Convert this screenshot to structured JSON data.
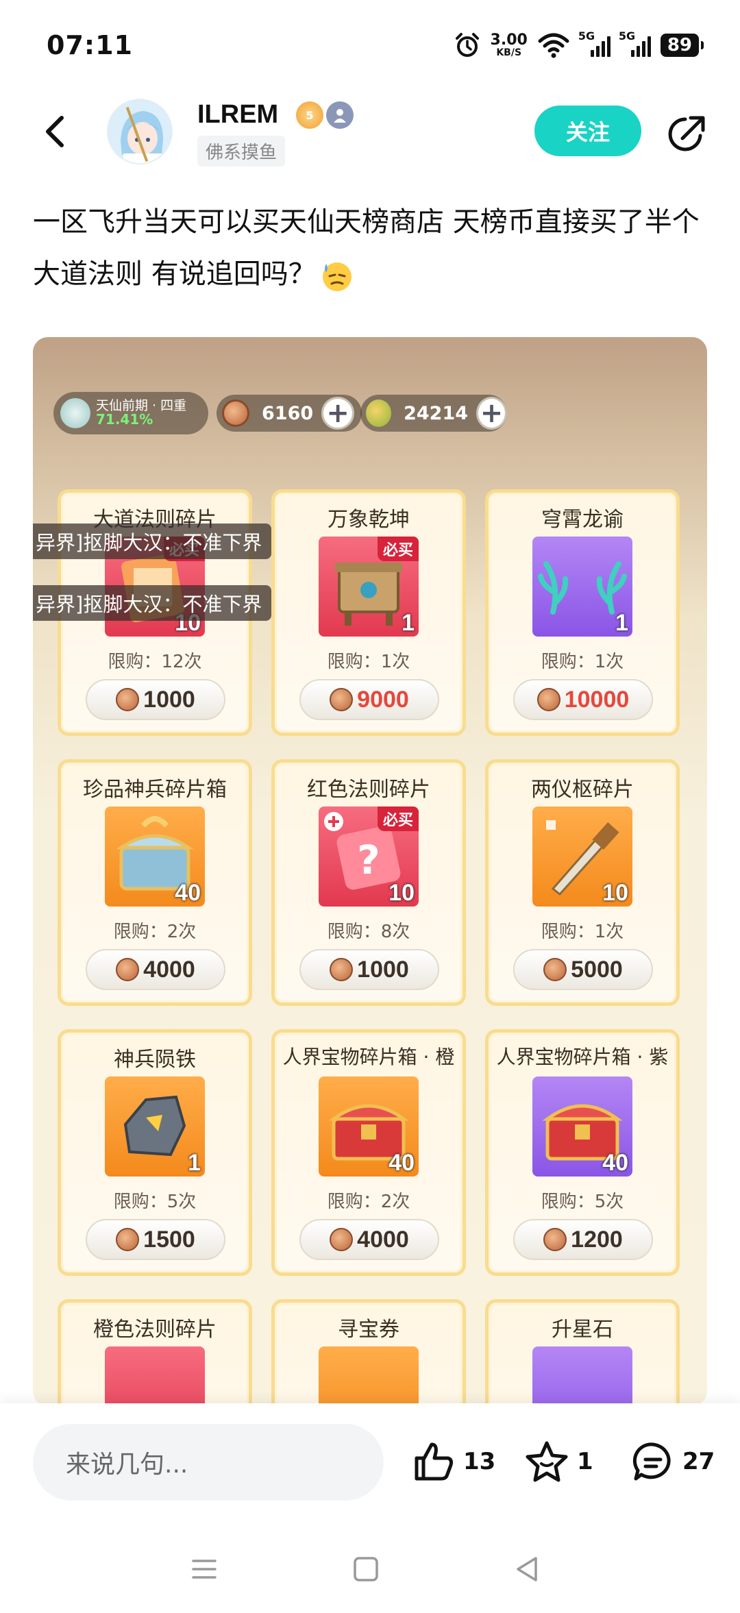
{
  "status_bar": {
    "time": "07:11",
    "network_speed_value": "3.00",
    "network_speed_unit": "KB/S",
    "signal1_label": "5G",
    "signal2_label": "5G",
    "battery": "89"
  },
  "header": {
    "username": "ILREM",
    "level_badge": "5",
    "user_tag": "佛系摸鱼",
    "follow_label": "关注"
  },
  "post": {
    "text": "一区飞升当天可以买天仙天榜商店 天榜币直接买了半个大道法则 有说追回吗？"
  },
  "game": {
    "realm_name": "天仙前期 · 四重",
    "realm_progress": "71.41%",
    "currency1_value": "6160",
    "currency2_value": "24214",
    "plus_label": "+",
    "must_buy_label": "必买",
    "chat_messages": [
      "异界]抠脚大汉：不准下界",
      "异界]抠脚大汉：不准下界"
    ],
    "items": [
      {
        "name": "大道法则碎片",
        "qty": "10",
        "limit": "限购：12次",
        "price": "1000",
        "must_buy": true,
        "price_red": false,
        "color": "red"
      },
      {
        "name": "万象乾坤",
        "qty": "1",
        "limit": "限购：1次",
        "price": "9000",
        "must_buy": true,
        "price_red": true,
        "color": "red"
      },
      {
        "name": "穹霄龙谕",
        "qty": "1",
        "limit": "限购：1次",
        "price": "10000",
        "must_buy": false,
        "price_red": true,
        "color": "purple"
      },
      {
        "name": "珍品神兵碎片箱",
        "qty": "40",
        "limit": "限购：2次",
        "price": "4000",
        "must_buy": false,
        "price_red": false,
        "color": "orange"
      },
      {
        "name": "红色法则碎片",
        "qty": "10",
        "limit": "限购：8次",
        "price": "1000",
        "must_buy": true,
        "price_red": false,
        "color": "red"
      },
      {
        "name": "两仪枢碎片",
        "qty": "10",
        "limit": "限购：1次",
        "price": "5000",
        "must_buy": false,
        "price_red": false,
        "color": "orange"
      },
      {
        "name": "神兵陨铁",
        "qty": "1",
        "limit": "限购：5次",
        "price": "1500",
        "must_buy": false,
        "price_red": false,
        "color": "orange"
      },
      {
        "name": "人界宝物碎片箱 · 橙",
        "qty": "40",
        "limit": "限购：2次",
        "price": "4000",
        "must_buy": false,
        "price_red": false,
        "color": "orange"
      },
      {
        "name": "人界宝物碎片箱 · 紫",
        "qty": "40",
        "limit": "限购：5次",
        "price": "1200",
        "must_buy": false,
        "price_red": false,
        "color": "purple"
      },
      {
        "name": "橙色法则碎片",
        "color": "red"
      },
      {
        "name": "寻宝券",
        "color": "orange"
      },
      {
        "name": "升星石",
        "color": "purple"
      }
    ]
  },
  "bottom_bar": {
    "comment_placeholder": "来说几句...",
    "likes": "13",
    "favorites": "1",
    "comments": "27"
  },
  "icons": {
    "back": "chevron-left-icon",
    "share": "share-icon",
    "like": "thumbs-up-icon",
    "favorite": "star-icon",
    "comment": "comment-icon"
  },
  "colors": {
    "accent": "#19d3c5",
    "price_red": "#e6473c",
    "must_buy": "#d7233b"
  }
}
